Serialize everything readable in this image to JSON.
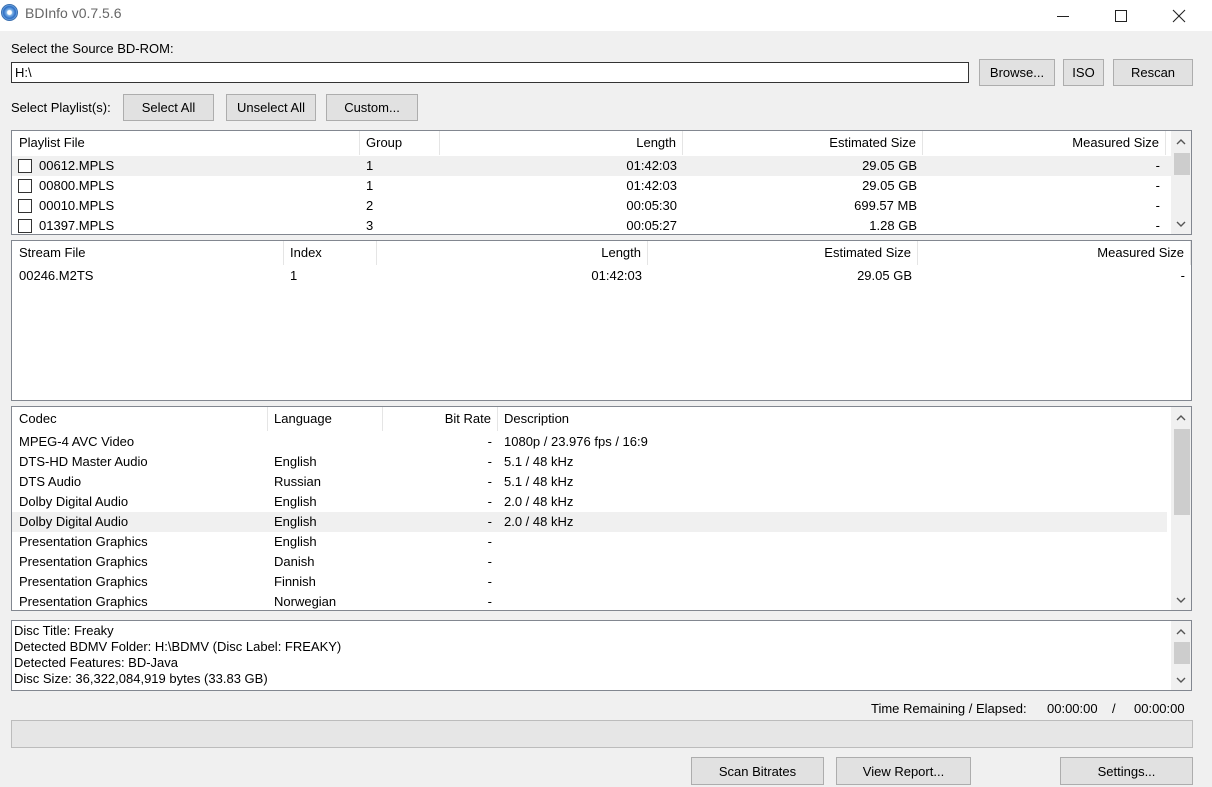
{
  "window": {
    "title": "BDInfo v0.7.5.6",
    "icon": "disc-icon",
    "controls": {
      "minimize": "minimize-icon",
      "maximize": "maximize-icon",
      "close": "close-icon"
    }
  },
  "source": {
    "label": "Select the Source BD-ROM:",
    "value": "H:\\",
    "browse_label": "Browse...",
    "iso_label": "ISO",
    "rescan_label": "Rescan"
  },
  "playlist_select": {
    "label": "Select Playlist(s):",
    "select_all_label": "Select All",
    "unselect_all_label": "Unselect All",
    "custom_label": "Custom..."
  },
  "playlists": {
    "columns": [
      "Playlist File",
      "Group",
      "Length",
      "Estimated Size",
      "Measured Size"
    ],
    "rows": [
      {
        "file": "00612.MPLS",
        "group": "1",
        "length": "01:42:03",
        "estimated": "29.05 GB",
        "measured": "-",
        "checked": false,
        "selected": true
      },
      {
        "file": "00800.MPLS",
        "group": "1",
        "length": "01:42:03",
        "estimated": "29.05 GB",
        "measured": "-",
        "checked": false,
        "selected": false
      },
      {
        "file": "00010.MPLS",
        "group": "2",
        "length": "00:05:30",
        "estimated": "699.57 MB",
        "measured": "-",
        "checked": false,
        "selected": false
      },
      {
        "file": "01397.MPLS",
        "group": "3",
        "length": "00:05:27",
        "estimated": "1.28 GB",
        "measured": "-",
        "checked": false,
        "selected": false
      }
    ]
  },
  "streams": {
    "columns": [
      "Stream File",
      "Index",
      "Length",
      "Estimated Size",
      "Measured Size"
    ],
    "rows": [
      {
        "file": "00246.M2TS",
        "index": "1",
        "length": "01:42:03",
        "estimated": "29.05 GB",
        "measured": "-"
      }
    ]
  },
  "codecs": {
    "columns": [
      "Codec",
      "Language",
      "Bit Rate",
      "Description"
    ],
    "rows": [
      {
        "codec": "MPEG-4 AVC Video",
        "language": "",
        "bitrate": "-",
        "description": "1080p / 23.976 fps / 16:9",
        "selected": false
      },
      {
        "codec": "DTS-HD Master Audio",
        "language": "English",
        "bitrate": "-",
        "description": "5.1 / 48 kHz",
        "selected": false
      },
      {
        "codec": "DTS Audio",
        "language": "Russian",
        "bitrate": "-",
        "description": "5.1 / 48 kHz",
        "selected": false
      },
      {
        "codec": "Dolby Digital Audio",
        "language": "English",
        "bitrate": "-",
        "description": "2.0 / 48 kHz",
        "selected": false
      },
      {
        "codec": "Dolby Digital Audio",
        "language": "English",
        "bitrate": "-",
        "description": "2.0 / 48 kHz",
        "selected": true
      },
      {
        "codec": "Presentation Graphics",
        "language": "English",
        "bitrate": "-",
        "description": "",
        "selected": false
      },
      {
        "codec": "Presentation Graphics",
        "language": "Danish",
        "bitrate": "-",
        "description": "",
        "selected": false
      },
      {
        "codec": "Presentation Graphics",
        "language": "Finnish",
        "bitrate": "-",
        "description": "",
        "selected": false
      },
      {
        "codec": "Presentation Graphics",
        "language": "Norwegian",
        "bitrate": "-",
        "description": "",
        "selected": false
      }
    ]
  },
  "disc_info": [
    "Disc Title: Freaky",
    "Detected BDMV Folder: H:\\BDMV (Disc Label: FREAKY)",
    "Detected Features: BD-Java",
    "Disc Size: 36,322,084,919 bytes (33.83 GB)"
  ],
  "timer": {
    "label": "Time Remaining / Elapsed:",
    "remaining": "00:00:00",
    "separator": "/",
    "elapsed": "00:00:00"
  },
  "progress": {
    "fraction": 0
  },
  "footer": {
    "scan_label": "Scan Bitrates",
    "report_label": "View Report...",
    "settings_label": "Settings..."
  }
}
